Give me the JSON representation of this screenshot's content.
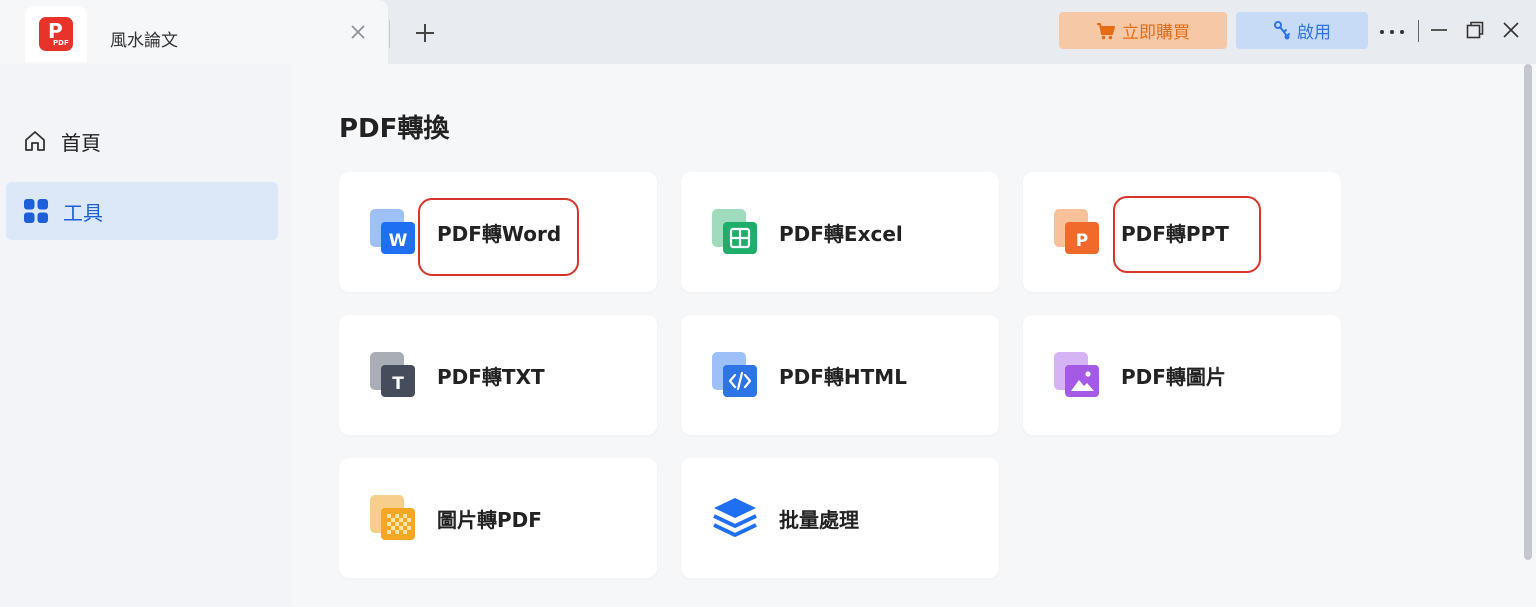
{
  "tab": {
    "title": "風水論文",
    "logo_text": "PDF"
  },
  "header": {
    "buy_label": "立即購買",
    "activate_label": "啟用"
  },
  "sidebar": {
    "items": [
      {
        "label": "首頁"
      },
      {
        "label": "工具"
      }
    ]
  },
  "main": {
    "section_title": "PDF轉換",
    "tools": [
      {
        "label": "PDF轉Word",
        "icon": "word-icon",
        "color": "#1e6ff2"
      },
      {
        "label": "PDF轉Excel",
        "icon": "excel-icon",
        "color": "#1fae6a"
      },
      {
        "label": "PDF轉PPT",
        "icon": "ppt-icon",
        "color": "#f06b2b"
      },
      {
        "label": "PDF轉TXT",
        "icon": "txt-icon",
        "color": "#454c5c"
      },
      {
        "label": "PDF轉HTML",
        "icon": "html-icon",
        "color": "#2f74e5"
      },
      {
        "label": "PDF轉圖片",
        "icon": "image-icon",
        "color": "#a55ae6"
      },
      {
        "label": "圖片轉PDF",
        "icon": "image-to-pdf-icon",
        "color": "#f5a623"
      },
      {
        "label": "批量處理",
        "icon": "batch-icon",
        "color": "#1e6ff2"
      }
    ]
  },
  "colors": {
    "accent": "#1d5fd8",
    "brand": "#e8332a",
    "buy": "#e56c17",
    "highlight": "#d8352a"
  }
}
